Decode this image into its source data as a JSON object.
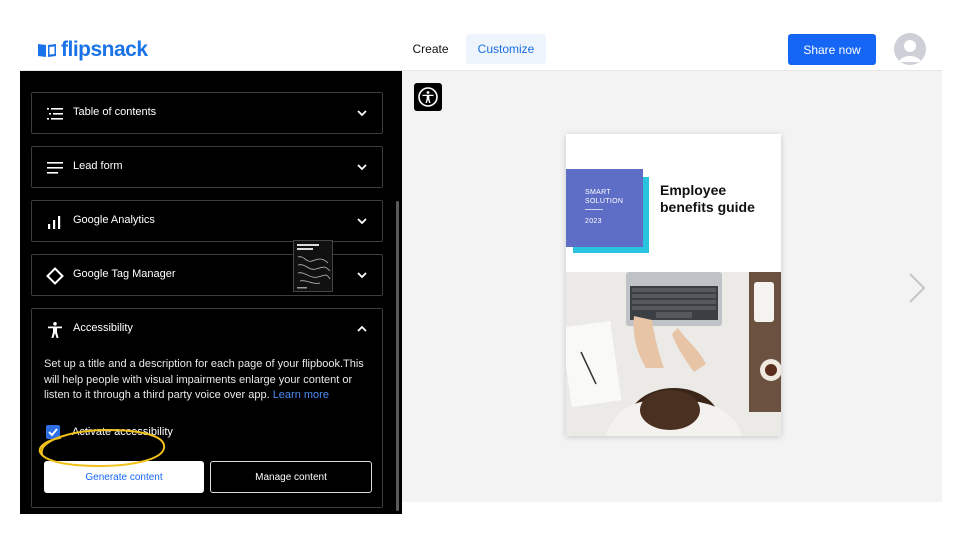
{
  "header": {
    "logo_text": "flipsnack",
    "tabs": [
      "Create",
      "Customize"
    ],
    "active_tab": "Customize",
    "share_label": "Share now"
  },
  "sidebar": {
    "items": [
      {
        "label": "Table of contents",
        "icon": "list-icon",
        "expanded": false
      },
      {
        "label": "Lead form",
        "icon": "lines-icon",
        "expanded": false
      },
      {
        "label": "Google Analytics",
        "icon": "bar-chart-icon",
        "expanded": false
      },
      {
        "label": "Google Tag Manager",
        "icon": "diamond-icon",
        "expanded": false
      },
      {
        "label": "Accessibility",
        "icon": "accessibility-icon",
        "expanded": true
      }
    ],
    "accessibility": {
      "description": "Set up a title and a description for each page of your flipbook.This will help people with visual impairments enlarge your content or listen to it through a third party voice over app. ",
      "learn_more": "Learn more",
      "checkbox_label": "Activate accessibility",
      "checkbox_checked": true,
      "generate_label": "Generate content",
      "manage_label": "Manage content"
    }
  },
  "preview": {
    "cover_tag_line1": "SMART",
    "cover_tag_line2": "SOLUTION",
    "cover_year": "2023",
    "cover_title": "Employee benefits guide"
  },
  "colors": {
    "brand": "#1a73e8",
    "primary_button": "#1666f5",
    "cover_purple": "#5e6ec7",
    "cover_cyan": "#27c3df",
    "highlight_circle": "#f2c21b"
  }
}
